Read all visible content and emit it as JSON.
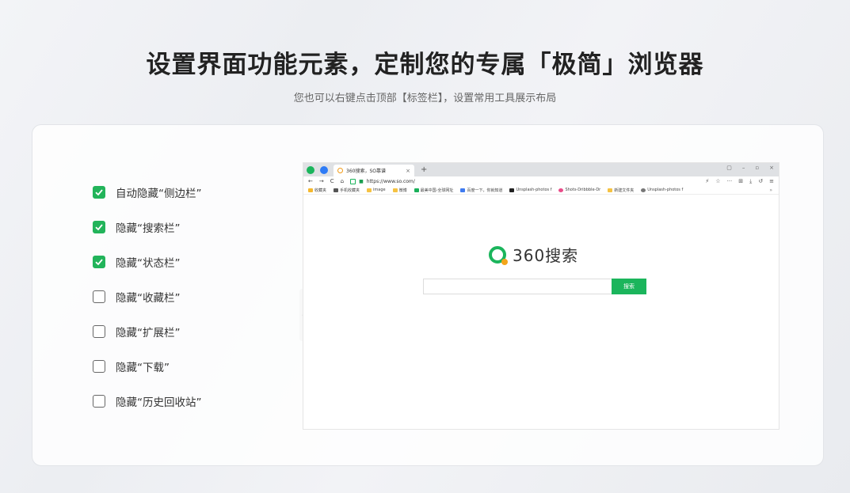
{
  "hero": {
    "title": "设置界面功能元素，定制您的专属「极简」浏览器",
    "subtitle": "您也可以右键点击顶部【标签栏】，设置常用工具展示布局"
  },
  "options": [
    {
      "label": "自动隐藏“侧边栏”",
      "checked": true
    },
    {
      "label": "隐藏“搜索栏”",
      "checked": true
    },
    {
      "label": "隐藏“状态栏”",
      "checked": true
    },
    {
      "label": "隐藏“收藏栏”",
      "checked": false
    },
    {
      "label": "隐藏“扩展栏”",
      "checked": false
    },
    {
      "label": "隐藏“下载”",
      "checked": false
    },
    {
      "label": "隐藏“历史回收站”",
      "checked": false
    }
  ],
  "browser": {
    "tab_title": "360搜索，SO靠谱",
    "tab_close": "×",
    "new_tab": "+",
    "url": "https://www.so.com/",
    "window_controls": [
      "▢",
      "–",
      "▫",
      "×"
    ],
    "nav": {
      "back": "←",
      "forward": "→",
      "reload": "C",
      "home": "⌂"
    },
    "toolbar_right": [
      "⚡",
      "☆",
      "···",
      "⊞",
      "⤓",
      "↺",
      "≡"
    ],
    "bookmarks": [
      {
        "label": "收藏夹",
        "color": "#f5b82e"
      },
      {
        "label": "手机收藏夹",
        "color": "#555555"
      },
      {
        "label": "image",
        "color": "#f5c243"
      },
      {
        "label": "微博",
        "color": "#f5c243"
      },
      {
        "label": "最美中国-全球网址",
        "color": "#1ab05a"
      },
      {
        "label": "百度一下，你就知道",
        "color": "#3f7bf0"
      },
      {
        "label": "Unsplash-photos f",
        "color": "#222222"
      },
      {
        "label": "Shots-Dribbble-Dr",
        "color": "#e94c89"
      },
      {
        "label": "新建文件夹",
        "color": "#f5c243"
      },
      {
        "label": "Unsplash-photos f",
        "color": "#777777"
      }
    ],
    "bookmarks_more": "»",
    "logo_text": "360搜索",
    "search_placeholder": "",
    "search_button": "搜索",
    "side_toggle": "‹"
  },
  "colors": {
    "accent_green": "#22b45a",
    "logo_orange": "#f3a51b"
  }
}
